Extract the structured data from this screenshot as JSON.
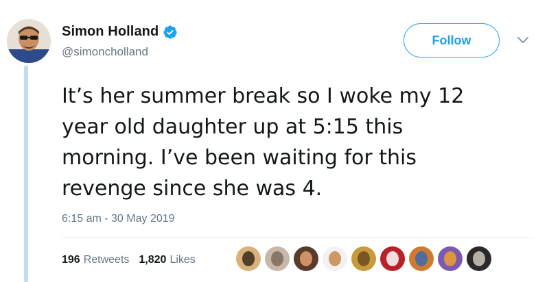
{
  "author": {
    "name": "Simon Holland",
    "handle": "@simoncholland",
    "verified": true,
    "avatar_icon": "profile-photo"
  },
  "follow_label": "Follow",
  "tweet": {
    "lines": [
      "It’s her summer break so I woke my 12",
      "year old daughter up at 5:15 this",
      "morning. I’ve been waiting for this",
      "revenge since she was 4."
    ],
    "timestamp": "6:15 am - 30 May 2019"
  },
  "stats": {
    "retweets_count": "196",
    "retweets_label": "Retweets",
    "likes_count": "1,820",
    "likes_label": "Likes"
  },
  "likers": [
    {
      "color": "#d8b27a",
      "accent": "#3a2a1e"
    },
    {
      "color": "#c9b8a8",
      "accent": "#7a6b5e"
    },
    {
      "color": "#5a3a2a",
      "accent": "#e8a070"
    },
    {
      "color": "#f2f2f2",
      "accent": "#c8874a"
    },
    {
      "color": "#c79a3c",
      "accent": "#6b4a1e"
    },
    {
      "color": "#b8202a",
      "accent": "#ffffff"
    },
    {
      "color": "#d07a30",
      "accent": "#3a6ab0"
    },
    {
      "color": "#7a5ab0",
      "accent": "#f0a030"
    },
    {
      "color": "#2a2a2a",
      "accent": "#d0c8c0"
    }
  ],
  "colors": {
    "brand_blue": "#1da1f2",
    "secondary_text": "#657786",
    "primary_text": "#14171a",
    "thread_line": "#c4dcf0"
  }
}
